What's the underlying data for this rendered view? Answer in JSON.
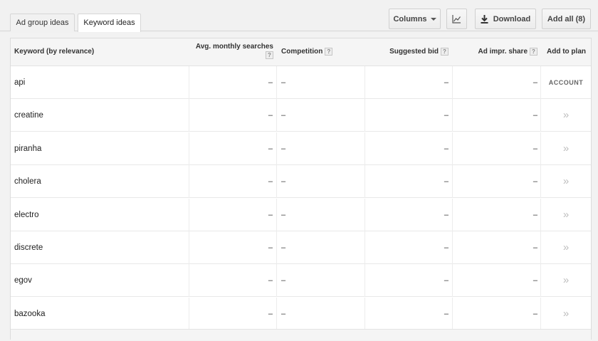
{
  "tabs": [
    {
      "label": "Ad group ideas",
      "active": false
    },
    {
      "label": "Keyword ideas",
      "active": true
    }
  ],
  "toolbar": {
    "columns_label": "Columns",
    "chart_icon": "line-chart-icon",
    "download_label": "Download",
    "download_icon": "download-icon",
    "add_all_label": "Add all (8)"
  },
  "table": {
    "headers": {
      "keyword": "Keyword (by relevance)",
      "avg_monthly_searches": "Avg. monthly searches",
      "competition": "Competition",
      "suggested_bid": "Suggested bid",
      "ad_impr_share": "Ad impr. share",
      "add_to_plan": "Add to plan",
      "help_glyph": "?"
    },
    "rows": [
      {
        "keyword": "api",
        "searches": "–",
        "competition": "–",
        "bid": "–",
        "share": "–",
        "add": "ACCOUNT"
      },
      {
        "keyword": "creatine",
        "searches": "–",
        "competition": "–",
        "bid": "–",
        "share": "–",
        "add": "»"
      },
      {
        "keyword": "piranha",
        "searches": "–",
        "competition": "–",
        "bid": "–",
        "share": "–",
        "add": "»"
      },
      {
        "keyword": "cholera",
        "searches": "–",
        "competition": "–",
        "bid": "–",
        "share": "–",
        "add": "»"
      },
      {
        "keyword": "electro",
        "searches": "–",
        "competition": "–",
        "bid": "–",
        "share": "–",
        "add": "»"
      },
      {
        "keyword": "discrete",
        "searches": "–",
        "competition": "–",
        "bid": "–",
        "share": "–",
        "add": "»"
      },
      {
        "keyword": "egov",
        "searches": "–",
        "competition": "–",
        "bid": "–",
        "share": "–",
        "add": "»"
      },
      {
        "keyword": "bazooka",
        "searches": "–",
        "competition": "–",
        "bid": "–",
        "share": "–",
        "add": "»"
      }
    ]
  }
}
